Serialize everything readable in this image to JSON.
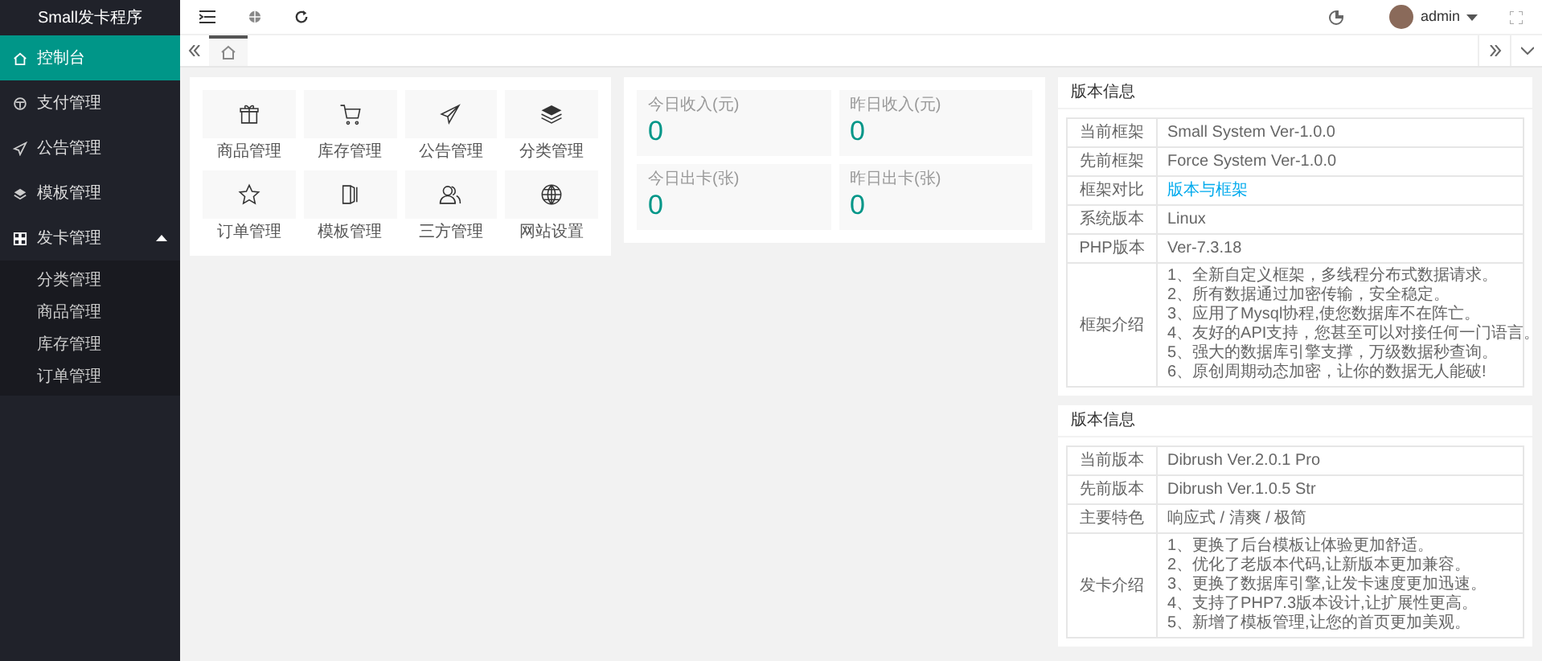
{
  "sidebar": {
    "logo": "Small发卡程序",
    "items": [
      {
        "label": "控制台",
        "selected": true
      },
      {
        "label": "支付管理",
        "selected": false
      },
      {
        "label": "公告管理",
        "selected": false
      },
      {
        "label": "模板管理",
        "selected": false
      },
      {
        "label": "发卡管理",
        "selected": false,
        "expanded": true,
        "children": [
          {
            "label": "分类管理"
          },
          {
            "label": "商品管理"
          },
          {
            "label": "库存管理"
          },
          {
            "label": "订单管理"
          }
        ]
      }
    ]
  },
  "header": {
    "user": "admin"
  },
  "tabs": [
    {
      "selected": true
    }
  ],
  "shortcuts": [
    {
      "label": "商品管理"
    },
    {
      "label": "库存管理"
    },
    {
      "label": "公告管理"
    },
    {
      "label": "分类管理"
    },
    {
      "label": "订单管理"
    },
    {
      "label": "模板管理"
    },
    {
      "label": "三方管理"
    },
    {
      "label": "网站设置"
    }
  ],
  "stats": [
    {
      "label": "今日收入(元)",
      "value": "0"
    },
    {
      "label": "昨日收入(元)",
      "value": "0"
    },
    {
      "label": "今日出卡(张)",
      "value": "0"
    },
    {
      "label": "昨日出卡(张)",
      "value": "0"
    }
  ],
  "panels": [
    {
      "title": "版本信息",
      "rows": [
        {
          "kind": "text",
          "label": "当前框架",
          "value": "Small System Ver-1.0.0"
        },
        {
          "kind": "text",
          "label": "先前框架",
          "value": "Force System Ver-1.0.0"
        },
        {
          "kind": "link",
          "label": "框架对比",
          "value": "版本与框架"
        },
        {
          "kind": "text",
          "label": "系统版本",
          "value": "Linux"
        },
        {
          "kind": "text",
          "label": "PHP版本",
          "value": "Ver-7.3.18"
        },
        {
          "kind": "list",
          "label": "框架介绍",
          "lines": [
            "1、全新自定义框架，多线程分布式数据请求。",
            "2、所有数据通过加密传输，安全稳定。",
            "3、应用了Mysql协程,使您数据库不在阵亡。",
            "4、友好的API支持，您甚至可以对接任何一门语言。",
            "5、强大的数据库引擎支撑，万级数据秒查询。",
            "6、原创周期动态加密，让你的数据无人能破!"
          ]
        }
      ]
    },
    {
      "title": "版本信息",
      "rows": [
        {
          "kind": "text",
          "label": "当前版本",
          "value": "Dibrush Ver.2.0.1 Pro"
        },
        {
          "kind": "text",
          "label": "先前版本",
          "value": "Dibrush Ver.1.0.5 Str"
        },
        {
          "kind": "text",
          "label": "主要特色",
          "value": "响应式 / 清爽 / 极简"
        },
        {
          "kind": "list",
          "label": "发卡介绍",
          "lines": [
            "1、更换了后台模板让体验更加舒适。",
            "2、优化了老版本代码,让新版本更加兼容。",
            "3、更换了数据库引擎,让发卡速度更加迅速。",
            "4、支持了PHP7.3版本设计,让扩展性更高。",
            "5、新增了模板管理,让您的首页更加美观。"
          ]
        }
      ]
    }
  ]
}
